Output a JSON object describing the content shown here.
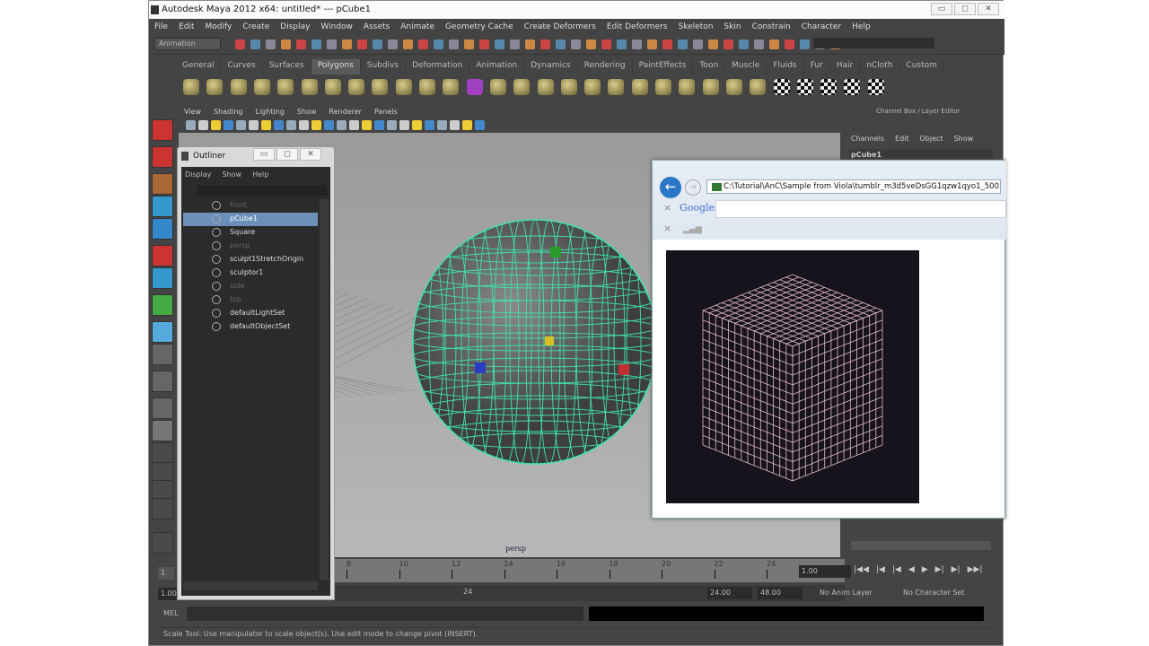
{
  "window": {
    "title": "Autodesk Maya 2012 x64: untitled*   ---   pCube1",
    "min": "▭",
    "max": "◻",
    "close": "✕"
  },
  "menu": [
    "File",
    "Edit",
    "Modify",
    "Create",
    "Display",
    "Window",
    "Assets",
    "Animate",
    "Geometry Cache",
    "Create Deformers",
    "Edit Deformers",
    "Skeleton",
    "Skin",
    "Constrain",
    "Character",
    "Help"
  ],
  "mode": "Animation",
  "shelf_tabs": [
    "General",
    "Curves",
    "Surfaces",
    "Polygons",
    "Subdivs",
    "Deformation",
    "Animation",
    "Dynamics",
    "Rendering",
    "PaintEffects",
    "Toon",
    "Muscle",
    "Fluids",
    "Fur",
    "Hair",
    "nCloth",
    "Custom"
  ],
  "active_shelf": "Polygons",
  "viewport": {
    "menu": [
      "View",
      "Shading",
      "Lighting",
      "Show",
      "Renderer",
      "Panels"
    ],
    "camera_label": "persp"
  },
  "channel_box": {
    "title": "Channel Box / Layer Editor",
    "menu": [
      "Channels",
      "Edit",
      "Object",
      "Show"
    ],
    "object": "pCube1"
  },
  "outliner": {
    "title": "Outliner",
    "menu": [
      "Display",
      "Show",
      "Help"
    ],
    "items": [
      {
        "label": "front",
        "dim": true
      },
      {
        "label": "pCube1",
        "selected": true
      },
      {
        "label": "Square"
      },
      {
        "label": "persp",
        "dim": true
      },
      {
        "label": "sculpt1StretchOrigin"
      },
      {
        "label": "sculptor1"
      },
      {
        "label": "side",
        "dim": true
      },
      {
        "label": "top",
        "dim": true
      },
      {
        "label": "defaultLightSet"
      },
      {
        "label": "defaultObjectSet"
      }
    ]
  },
  "browser": {
    "address": "C:\\Tutorial\\AnC\\Sample from Viola\\tumblr_m3d5veDsGG1qzw1qyo1_500.",
    "google": "Google",
    "close": "×"
  },
  "timeline": {
    "ticks": [
      "8",
      "10",
      "12",
      "14",
      "16",
      "18",
      "20",
      "22",
      "24"
    ],
    "current_frame": "1.00",
    "start": "1.00",
    "range_start_frame": "1",
    "range_end": "24",
    "end_time": "24.00",
    "max_time": "48.00",
    "anim_layer": "No Anim Layer",
    "character_set": "No Character Set"
  },
  "mel": {
    "label": "MEL"
  },
  "help_line": "Scale Tool: Use manipulator to scale object(s). Use edit mode to change pivot (INSERT)."
}
